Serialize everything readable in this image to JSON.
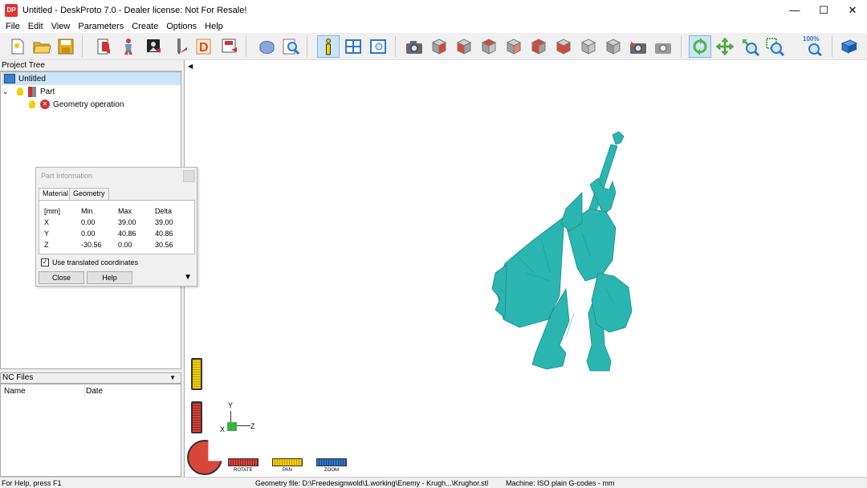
{
  "window": {
    "icon_text": "DP",
    "title": "Untitled - DeskProto 7.0 - Dealer license: Not For Resale!",
    "minimize": "—",
    "maximize": "☐",
    "close": "✕"
  },
  "menu": [
    "File",
    "Edit",
    "View",
    "Parameters",
    "Create",
    "Options",
    "Help"
  ],
  "toolbar": {
    "zoom_label": "100%",
    "active": "info-button",
    "colors": {
      "red": "#d9463a",
      "gray": "#a0a0a0",
      "green": "#4fb342",
      "yellow": "#f5d000",
      "blue": "#2e78c8"
    }
  },
  "project_tree": {
    "header": "Project Tree",
    "items": [
      {
        "label": "Untitled",
        "level": "root",
        "selected": true
      },
      {
        "label": "Part",
        "level": "1"
      },
      {
        "label": "Geometry operation",
        "level": "2"
      }
    ]
  },
  "nc_files": {
    "header": "NC Files",
    "columns": [
      "Name",
      "Date"
    ]
  },
  "part_info": {
    "title": "Part Information",
    "tabs": [
      "Material",
      "Geometry"
    ],
    "active_tab": "Material",
    "table": {
      "headers": [
        "[mm]",
        "Min",
        "Max",
        "Delta"
      ],
      "rows": [
        [
          "X",
          "0.00",
          "39.00",
          "39.00"
        ],
        [
          "Y",
          "0.00",
          "40.86",
          "40.86"
        ],
        [
          "Z",
          "-30.56",
          "0.00",
          "30.56"
        ]
      ]
    },
    "checkbox_label": "Use translated coordinates",
    "checkbox_checked": true,
    "close_label": "Close",
    "help_label": "Help"
  },
  "viewport": {
    "model_color": "#2bb5b0",
    "axes": {
      "y": "Y",
      "x": "X",
      "z": "Z"
    },
    "controls": {
      "rotate": "ROTATE",
      "pan": "PAN",
      "zoom": "ZOOM"
    }
  },
  "status": {
    "help": "For Help, press F1",
    "geometry": "Geometry file: D:\\Freedesignwold\\1.working\\Enemy - Krugh...\\Krughor.stl",
    "machine": "Machine: ISO plain G-codes - mm"
  }
}
